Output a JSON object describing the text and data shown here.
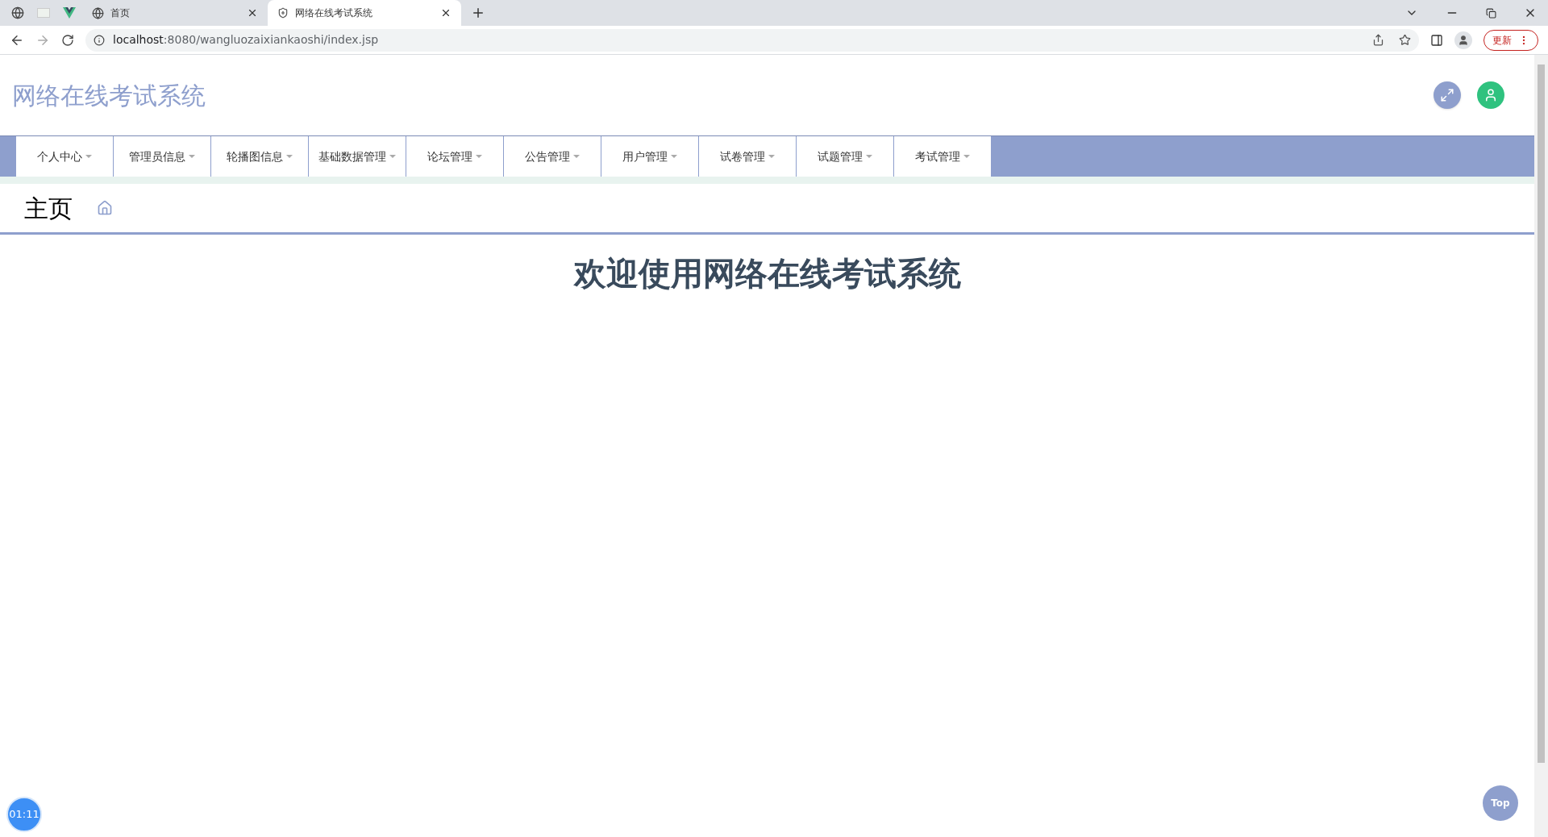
{
  "browser": {
    "tabs": [
      {
        "title": "首页",
        "selected": false
      },
      {
        "title": "网络在线考试系统",
        "selected": true
      }
    ],
    "address": {
      "host": "localhost",
      "rest": ":8080/wangluozaixiankaoshi/index.jsp"
    },
    "update_button": "更新"
  },
  "header": {
    "title": "网络在线考试系统"
  },
  "nav": {
    "items": [
      {
        "label": "个人中心"
      },
      {
        "label": "管理员信息"
      },
      {
        "label": "轮播图信息"
      },
      {
        "label": "基础数据管理"
      },
      {
        "label": "论坛管理"
      },
      {
        "label": "公告管理"
      },
      {
        "label": "用户管理"
      },
      {
        "label": "试卷管理"
      },
      {
        "label": "试题管理"
      },
      {
        "label": "考试管理"
      }
    ]
  },
  "breadcrumb": {
    "title": "主页"
  },
  "welcome": "欢迎使用网络在线考试系统",
  "timer": "01:11",
  "top_button": "Top"
}
